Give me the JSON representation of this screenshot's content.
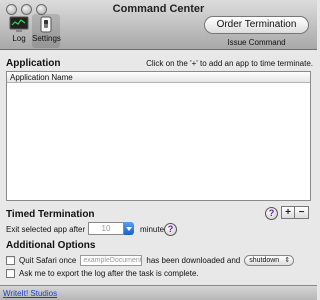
{
  "window": {
    "title": "Command Center"
  },
  "toolbar": {
    "log_label": "Log",
    "settings_label": "Settings",
    "order_button": "Order Termination",
    "order_caption": "Issue Command"
  },
  "application": {
    "title": "Application",
    "hint": "Click on the '+' to add an app to time terminate.",
    "columns": [
      "Application Name"
    ],
    "rows": []
  },
  "timed": {
    "title": "Timed Termination",
    "exit_prefix": "Exit selected app after",
    "minutes_value": "10",
    "minutes_suffix": "minutes.",
    "help": "?",
    "plus": "+",
    "minus": "−"
  },
  "options": {
    "title": "Additional Options",
    "quit_prefix": "Quit Safari once",
    "document_placeholder": "exampleDocument.p",
    "quit_middle": "has been downloaded and",
    "action_selected": "shutdown",
    "export_label": "Ask me to export the log after the task is complete."
  },
  "footer": {
    "link": "WriteIt! Studios"
  },
  "colors": {
    "link": "#1a3fd1",
    "help_glyph": "#6a1a9a",
    "combo_arrow": "#1d5fc8"
  }
}
